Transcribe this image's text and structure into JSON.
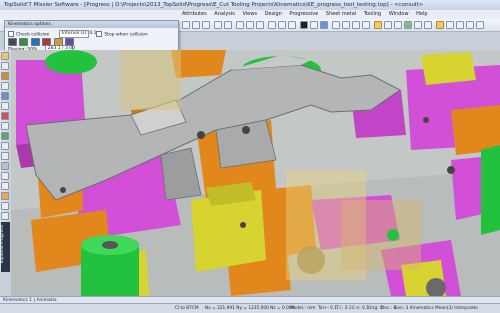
{
  "window": {
    "title": "TopSolid'7 Missler Software - [Progress | D:\\Projects\\2013_TopSolid\\Progress\\E_Cut Tooling Projects\\Kinematics\\KE_progress_tool_testing.top] - <consult>",
    "buttons": {
      "minimize": "–",
      "maximize": "□",
      "close": "✕"
    }
  },
  "menu": [
    "Attributes",
    "Analysis",
    "Views",
    "Design",
    "Progressive",
    "Sheet metal",
    "Tooling",
    "Window",
    "Help"
  ],
  "panel": {
    "title": "Kinematics options",
    "check_collision": "Check collision",
    "interval_label": "Interval (s): 0.1",
    "stop_on_collision": "Stop when collision",
    "playing_label": "Playing: 50%",
    "time_value": "283.1 / 3.00"
  },
  "left_tab": "TopSolid'Progress",
  "bottom_tab": "Kinematics 1 | Animatio",
  "status": {
    "mode": "Cl.to B7CM",
    "coords": "Nx = 221.991  Ny = 1235.000  Nz = 0.000",
    "mode2": "Model.: mm",
    "tol": "Tol+: 0.1",
    "t": "T.l.: 0.2",
    "c": "C-n: 0.1",
    "orig": "Orig: 0",
    "deg": "Dec.: 0",
    "gen": "Gen: 3",
    "kin": "Kinematics  Mean(3)  Interpolate"
  },
  "colors": {
    "magenta": "#d24fd7",
    "orange": "#e2871c",
    "yellow": "#d7d331",
    "green": "#23c23e",
    "steel": "#a9aaab",
    "bg": "#c3c7c6"
  }
}
